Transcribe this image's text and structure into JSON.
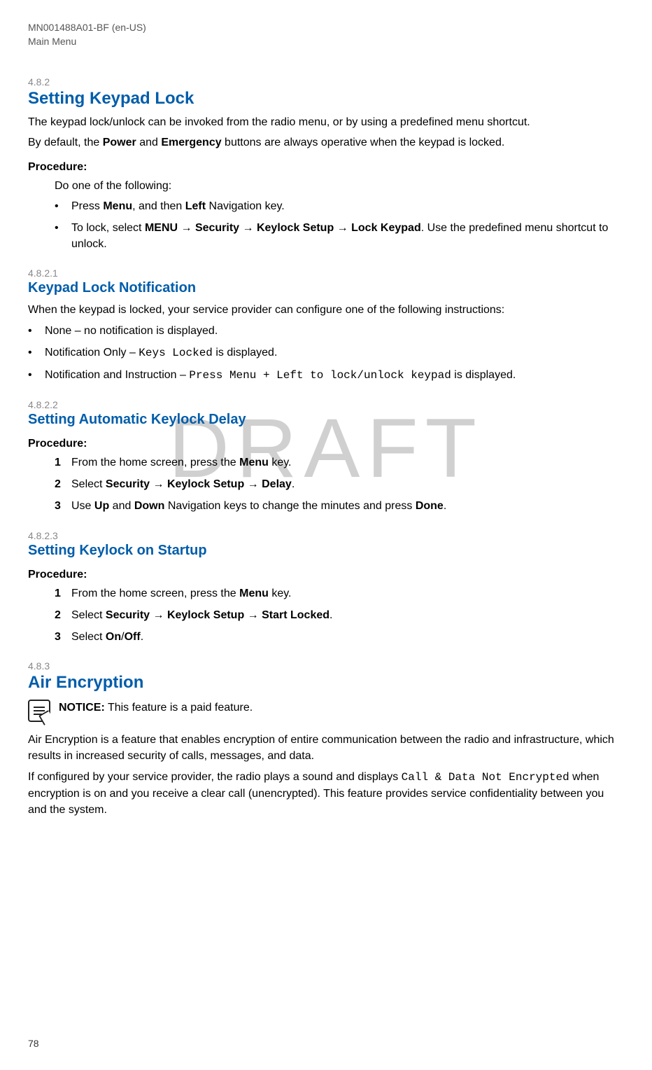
{
  "header": {
    "doc_id": "MN001488A01-BF (en-US)",
    "section_path": "Main Menu"
  },
  "watermark": "DRAFT",
  "sections": {
    "s482": {
      "number": "4.8.2",
      "title": "Setting Keypad Lock",
      "p1": "The keypad lock/unlock can be invoked from the radio menu, or by using a predefined menu shortcut.",
      "p2_prefix": "By default, the ",
      "p2_b1": "Power",
      "p2_mid": " and ",
      "p2_b2": "Emergency",
      "p2_suffix": " buttons are always operative when the keypad is locked.",
      "procedure_label": "Procedure:",
      "instruction": "Do one of the following:",
      "bullet1_prefix": "Press ",
      "bullet1_b1": "Menu",
      "bullet1_mid": ", and then ",
      "bullet1_b2": "Left",
      "bullet1_suffix": " Navigation key.",
      "bullet2_prefix": "To lock, select ",
      "bullet2_b1": "MENU",
      "bullet2_arrow1": " → ",
      "bullet2_b2": "Security",
      "bullet2_arrow2": " → ",
      "bullet2_b3": "Keylock Setup",
      "bullet2_arrow3": " → ",
      "bullet2_b4": "Lock Keypad",
      "bullet2_suffix": ". Use the predefined menu shortcut to unlock."
    },
    "s4821": {
      "number": "4.8.2.1",
      "title": "Keypad Lock Notification",
      "p1": "When the keypad is locked, your service provider can configure one of the following instructions:",
      "b1": "None – no notification is displayed.",
      "b2_prefix": "Notification Only – ",
      "b2_mono": "Keys Locked",
      "b2_suffix": " is displayed.",
      "b3_prefix": "Notification and Instruction – ",
      "b3_mono": "Press Menu + Left to lock/unlock keypad",
      "b3_suffix": " is displayed."
    },
    "s4822": {
      "number": "4.8.2.2",
      "title": "Setting Automatic Keylock Delay",
      "procedure_label": "Procedure:",
      "step1_num": "1",
      "step1_prefix": "From the home screen, press the ",
      "step1_b1": "Menu",
      "step1_suffix": " key.",
      "step2_num": "2",
      "step2_prefix": "Select ",
      "step2_b1": "Security",
      "step2_arrow1": " → ",
      "step2_b2": "Keylock Setup",
      "step2_arrow2": " → ",
      "step2_b3": "Delay",
      "step2_suffix": ".",
      "step3_num": "3",
      "step3_prefix": "Use ",
      "step3_b1": "Up",
      "step3_mid": " and ",
      "step3_b2": "Down",
      "step3_mid2": " Navigation keys to change the minutes and press ",
      "step3_b3": "Done",
      "step3_suffix": "."
    },
    "s4823": {
      "number": "4.8.2.3",
      "title": "Setting Keylock on Startup",
      "procedure_label": "Procedure:",
      "step1_num": "1",
      "step1_prefix": "From the home screen, press the ",
      "step1_b1": "Menu",
      "step1_suffix": " key.",
      "step2_num": "2",
      "step2_prefix": "Select ",
      "step2_b1": "Security",
      "step2_arrow1": " → ",
      "step2_b2": "Keylock Setup",
      "step2_arrow2": " → ",
      "step2_b3": "Start Locked",
      "step2_suffix": ".",
      "step3_num": "3",
      "step3_prefix": "Select ",
      "step3_b1": "On",
      "step3_mid": "/",
      "step3_b2": "Off",
      "step3_suffix": "."
    },
    "s483": {
      "number": "4.8.3",
      "title": "Air Encryption",
      "notice_label": "NOTICE:",
      "notice_text": " This feature is a paid feature.",
      "p1": "Air Encryption is a feature that enables encryption of entire communication between the radio and infrastructure, which results in increased security of calls, messages, and data.",
      "p2_prefix": "If configured by your service provider, the radio plays a sound and displays ",
      "p2_mono": "Call & Data Not Encrypted",
      "p2_suffix": " when encryption is on and you receive a clear call (unencrypted). This feature provides service confidentiality between you and the system."
    }
  },
  "page_number": "78"
}
